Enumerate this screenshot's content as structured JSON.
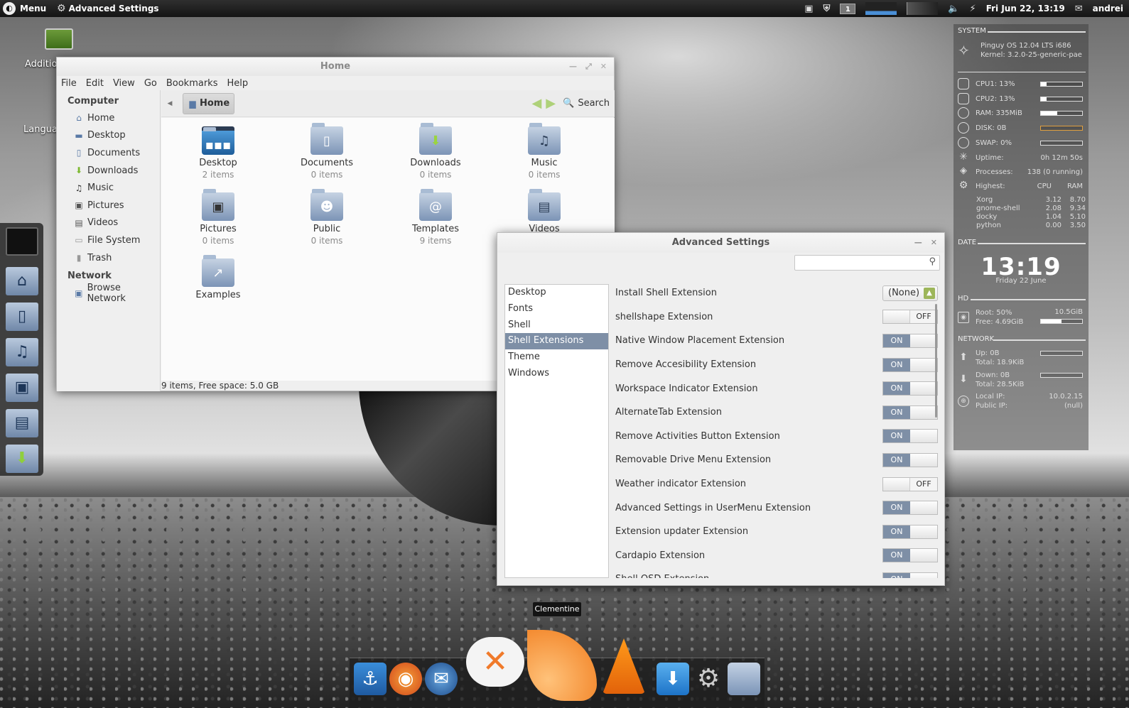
{
  "top_panel": {
    "menu_label": "Menu",
    "app_title": "Advanced Settings",
    "workspace": "1",
    "datetime": "Fri Jun 22, 13:19",
    "user": "andrei"
  },
  "desktop_icons": [
    {
      "label": "Additio"
    },
    {
      "label": "Langua"
    }
  ],
  "file_manager": {
    "title": "Home",
    "menu": [
      "File",
      "Edit",
      "View",
      "Go",
      "Bookmarks",
      "Help"
    ],
    "sidebar": {
      "computer_heading": "Computer",
      "places": [
        "Home",
        "Desktop",
        "Documents",
        "Downloads",
        "Music",
        "Pictures",
        "Videos",
        "File System",
        "Trash"
      ],
      "network_heading": "Network",
      "network_items": [
        "Browse Network"
      ]
    },
    "breadcrumb": "Home",
    "search_label": "Search",
    "files": [
      {
        "name": "Desktop",
        "count": "2 items"
      },
      {
        "name": "Documents",
        "count": "0 items"
      },
      {
        "name": "Downloads",
        "count": "0 items"
      },
      {
        "name": "Music",
        "count": "0 items"
      },
      {
        "name": "Pictures",
        "count": "0 items"
      },
      {
        "name": "Public",
        "count": "0 items"
      },
      {
        "name": "Templates",
        "count": "9 items"
      },
      {
        "name": "Videos",
        "count": ""
      },
      {
        "name": "Examples",
        "count": ""
      }
    ],
    "status": "9 items, Free space: 5.0 GB"
  },
  "advanced_settings": {
    "title": "Advanced Settings",
    "search_placeholder": "",
    "categories": [
      "Desktop",
      "Fonts",
      "Shell",
      "Shell Extensions",
      "Theme",
      "Windows"
    ],
    "selected_category": "Shell Extensions",
    "install_label": "Install Shell Extension",
    "install_value": "(None)",
    "on_label": "ON",
    "off_label": "OFF",
    "extensions": [
      {
        "name": "shellshape Extension",
        "state": "OFF"
      },
      {
        "name": "Native Window Placement Extension",
        "state": "ON"
      },
      {
        "name": "Remove Accesibility Extension",
        "state": "ON"
      },
      {
        "name": "Workspace Indicator Extension",
        "state": "ON"
      },
      {
        "name": "AlternateTab Extension",
        "state": "ON"
      },
      {
        "name": "Remove Activities Button Extension",
        "state": "ON"
      },
      {
        "name": "Removable Drive Menu Extension",
        "state": "ON"
      },
      {
        "name": "Weather indicator Extension",
        "state": "OFF"
      },
      {
        "name": "Advanced Settings in UserMenu Extension",
        "state": "ON"
      },
      {
        "name": "Extension updater Extension",
        "state": "ON"
      },
      {
        "name": "Cardapio Extension",
        "state": "ON"
      },
      {
        "name": "Shell OSD Extension",
        "state": "ON"
      }
    ]
  },
  "conky": {
    "system_head": "SYSTEM",
    "os": "Pinguy OS 12.04 LTS i686",
    "kernel": "Kernel: 3.2.0-25-generic-pae",
    "cpu1": "CPU1: 13%",
    "cpu1_level": 0.13,
    "cpu2": "CPU2: 13%",
    "cpu2_level": 0.13,
    "ram": "RAM: 335MiB",
    "ram_level": 0.4,
    "disk": "DISK: 0B",
    "swap": "SWAP: 0%",
    "uptime_label": "Uptime:",
    "uptime_value": "0h 12m 50s",
    "processes_label": "Processes:",
    "processes_value": "138 (0 running)",
    "highest_label": "Highest:",
    "cpu_col": "CPU",
    "ram_col": "RAM",
    "procs": [
      {
        "name": "Xorg",
        "cpu": "3.12",
        "ram": "8.70"
      },
      {
        "name": "gnome-shell",
        "cpu": "2.08",
        "ram": "9.34"
      },
      {
        "name": "docky",
        "cpu": "1.04",
        "ram": "5.10"
      },
      {
        "name": "python",
        "cpu": "0.00",
        "ram": "3.50"
      }
    ],
    "date_head": "DATE",
    "time": "13:19",
    "date": "Friday 22 June",
    "hd_head": "HD",
    "root": "Root: 50%",
    "root_size": "10.5GiB",
    "root_level": 0.5,
    "free": "Free: 4.69GiB",
    "network_head": "NETWORK",
    "up": "Up: 0B",
    "up_total": "Total: 18.9KiB",
    "down": "Down: 0B",
    "down_total": "Total: 28.5KiB",
    "local_ip_label": "Local IP:",
    "local_ip": "10.0.2.15",
    "public_ip_label": "Public IP:",
    "public_ip": "(null)"
  },
  "dock": {
    "tooltip": "Clementine"
  }
}
